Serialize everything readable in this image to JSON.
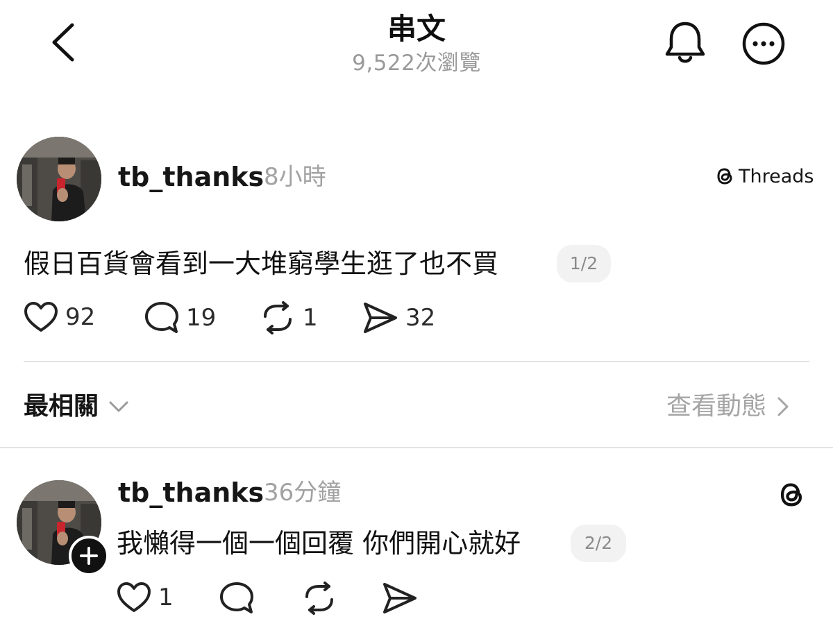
{
  "header": {
    "title": "串文",
    "views": "9,522次瀏覽"
  },
  "post": {
    "username": "tb_thanks",
    "time": "8小時",
    "platform_label": "Threads",
    "text": "假日百貨會看到一大堆窮學生逛了也不買",
    "page_indicator": "1/2",
    "likes": "92",
    "comments": "19",
    "reposts": "1",
    "shares": "32"
  },
  "sort": {
    "label": "最相關",
    "view_activity": "查看動態"
  },
  "reply": {
    "username": "tb_thanks",
    "time": "36分鐘",
    "text": "我懶得一個一個回覆 你們開心就好",
    "page_indicator": "2/2",
    "likes": "1"
  },
  "colors": {
    "text": "#111111",
    "muted": "#9a9a9a",
    "divider": "#e3e3e3",
    "pill_bg": "#f2f2f2"
  }
}
